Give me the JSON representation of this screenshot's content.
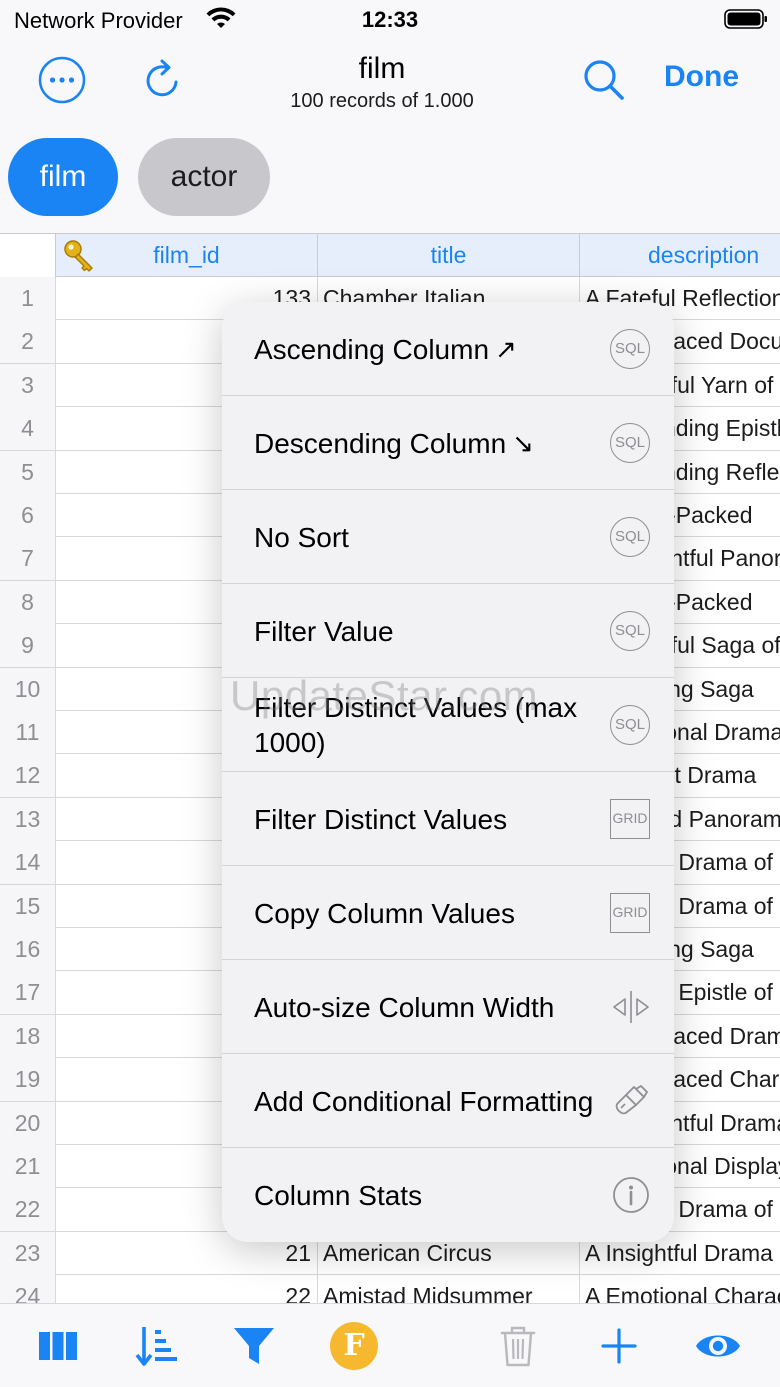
{
  "status": {
    "carrier": "Network Provider",
    "time": "12:33"
  },
  "nav": {
    "title": "film",
    "subtitle": "100 records of 1.000",
    "done_label": "Done"
  },
  "tabs": [
    {
      "label": "film",
      "active": true
    },
    {
      "label": "actor",
      "active": false
    }
  ],
  "table": {
    "columns": [
      "film_id",
      "title",
      "description"
    ],
    "rows": [
      {
        "num": "1",
        "film_id": "133",
        "title": "Chamber Italian",
        "description": "A Fateful Reflection"
      },
      {
        "num": "2",
        "film_id": "",
        "title": "",
        "description": "A Fast-Paced Documentary"
      },
      {
        "num": "3",
        "film_id": "",
        "title": "",
        "description": "A Beautiful Yarn of"
      },
      {
        "num": "4",
        "film_id": "",
        "title": "",
        "description": "A Astounding Epistle"
      },
      {
        "num": "5",
        "film_id": "",
        "title": "",
        "description": "A Astounding Reflection"
      },
      {
        "num": "6",
        "film_id": "",
        "title": "",
        "description": "A Action-Packed"
      },
      {
        "num": "7",
        "film_id": "",
        "title": "",
        "description": "A Thoughtful Panorama"
      },
      {
        "num": "8",
        "film_id": "",
        "title": "",
        "description": "A Action-Packed"
      },
      {
        "num": "9",
        "film_id": "",
        "title": "",
        "description": "A Beautiful Saga of"
      },
      {
        "num": "10",
        "film_id": "",
        "title": "",
        "description": "A Amazing Saga"
      },
      {
        "num": "11",
        "film_id": "",
        "title": "",
        "description": "A Emotional Drama"
      },
      {
        "num": "12",
        "film_id": "",
        "title": "",
        "description": "A Brilliant Drama"
      },
      {
        "num": "13",
        "film_id": "",
        "title": "",
        "description": "A Intrepid Panorama"
      },
      {
        "num": "14",
        "film_id": "",
        "title": "",
        "description": "A Boring Drama of a"
      },
      {
        "num": "15",
        "film_id": "",
        "title": "",
        "description": "A Boring Drama of a"
      },
      {
        "num": "16",
        "film_id": "",
        "title": "",
        "description": "A Amazing Saga"
      },
      {
        "num": "17",
        "film_id": "",
        "title": "",
        "description": "A Boring Epistle of"
      },
      {
        "num": "18",
        "film_id": "",
        "title": "",
        "description": "A Fast-Paced Drama"
      },
      {
        "num": "19",
        "film_id": "",
        "title": "",
        "description": "A Fast-Paced Character"
      },
      {
        "num": "20",
        "film_id": "",
        "title": "",
        "description": "A Thoughtful Drama"
      },
      {
        "num": "21",
        "film_id": "",
        "title": "",
        "description": "A Emotional Display"
      },
      {
        "num": "22",
        "film_id": "",
        "title": "",
        "description": "A Boring Drama of"
      },
      {
        "num": "23",
        "film_id": "21",
        "title": "American Circus",
        "description": "A Insightful Drama"
      },
      {
        "num": "24",
        "film_id": "22",
        "title": "Amistad Midsummer",
        "description": "A Emotional Character"
      }
    ]
  },
  "menu": {
    "items": [
      {
        "label": "Ascending Column",
        "arrow": "↗",
        "badge": "SQL",
        "badge_type": "sql"
      },
      {
        "label": "Descending Column",
        "arrow": "↘",
        "badge": "SQL",
        "badge_type": "sql"
      },
      {
        "label": "No Sort",
        "arrow": "",
        "badge": "SQL",
        "badge_type": "sql"
      },
      {
        "label": "Filter Value",
        "arrow": "",
        "badge": "SQL",
        "badge_type": "sql"
      },
      {
        "label": "Filter Distinct Values (max 1000)",
        "arrow": "",
        "badge": "SQL",
        "badge_type": "sql"
      },
      {
        "label": "Filter Distinct Values",
        "arrow": "",
        "badge": "GRID",
        "badge_type": "grid"
      },
      {
        "label": "Copy Column Values",
        "arrow": "",
        "badge": "GRID",
        "badge_type": "grid"
      },
      {
        "label": "Auto-size Column Width",
        "arrow": "",
        "badge": "",
        "badge_type": "resize"
      },
      {
        "label": "Add Conditional Formatting",
        "arrow": "",
        "badge": "",
        "badge_type": "brush"
      },
      {
        "label": "Column Stats",
        "arrow": "",
        "badge": "",
        "badge_type": "info"
      }
    ]
  },
  "watermark": "UpdateStar.com",
  "toolbar": {
    "formula_label": "F"
  },
  "colors": {
    "accent": "#1a84f5",
    "chip_inactive": "#c7c7cc",
    "formula_badge": "#f5b82e"
  }
}
